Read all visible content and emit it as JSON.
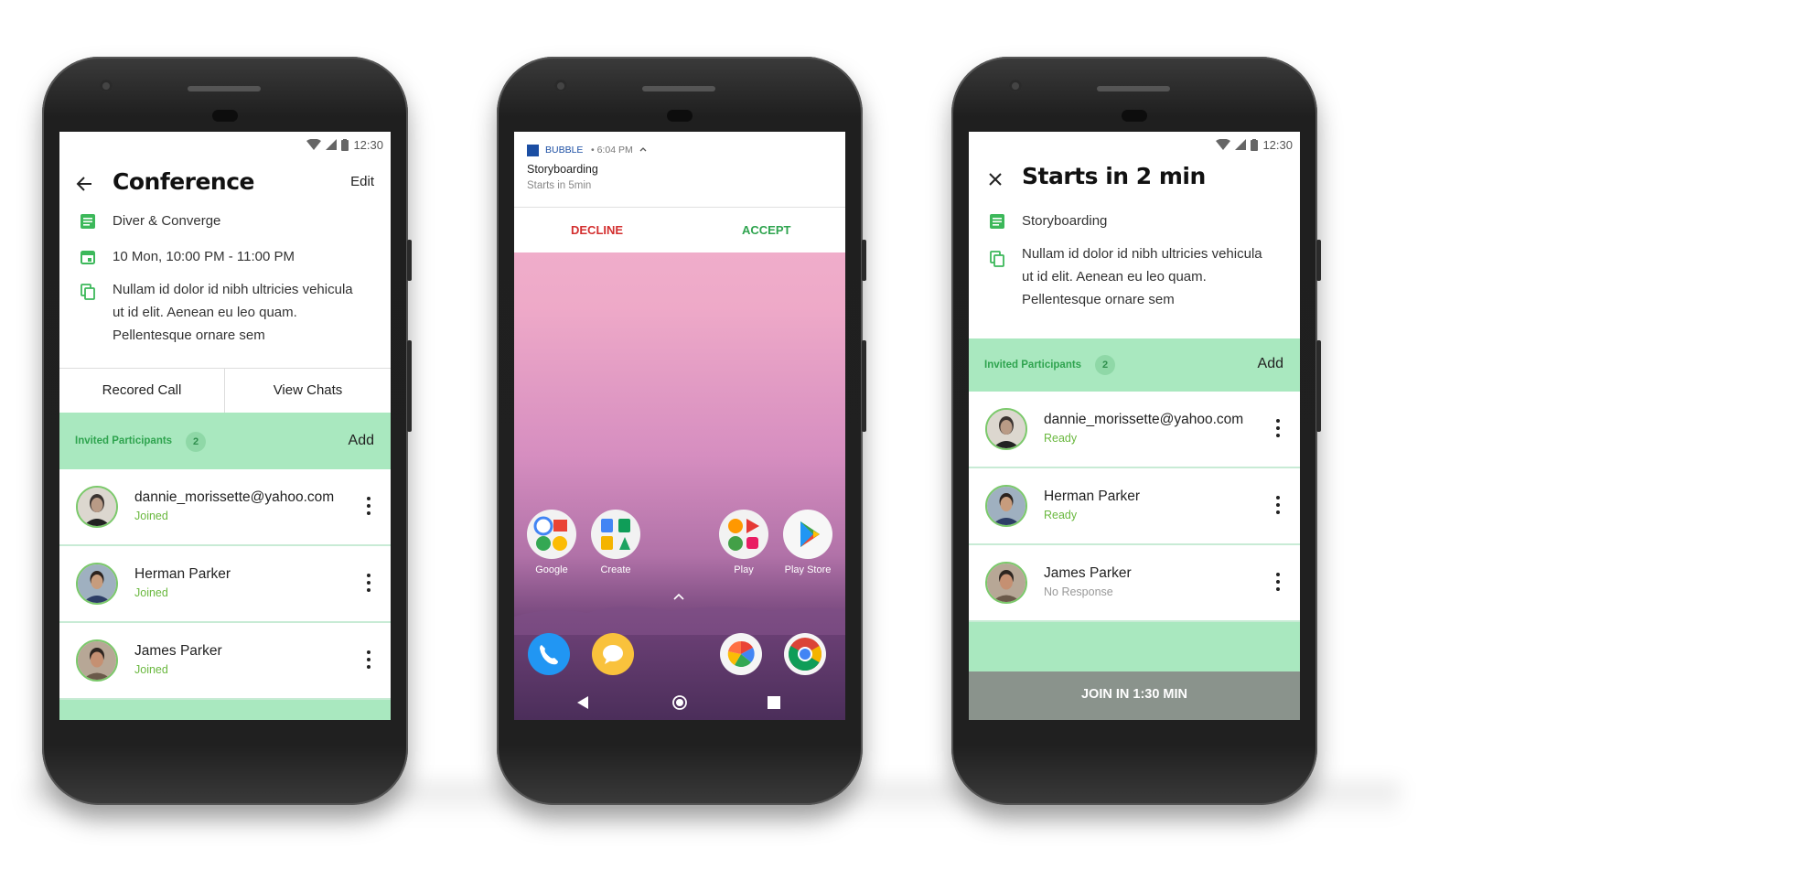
{
  "phone1": {
    "status_time": "12:30",
    "header": {
      "title": "Conference",
      "edit_label": "Edit"
    },
    "details": {
      "name": "Diver & Converge",
      "datetime": "10 Mon, 10:00 PM - 11:00 PM",
      "description_lines": [
        "Nullam id dolor id nibh ultricies vehicula",
        "ut id elit. Aenean eu leo quam.",
        "Pellentesque ornare sem"
      ]
    },
    "tabs": [
      "Recored Call",
      "View Chats"
    ],
    "participants_header": {
      "label": "Invited Participants",
      "count": "2",
      "add_label": "Add"
    },
    "participants": [
      {
        "name": "dannie_morissette@yahoo.com",
        "status": "Joined"
      },
      {
        "name": "Herman Parker",
        "status": "Joined"
      },
      {
        "name": "James Parker",
        "status": "Joined"
      }
    ]
  },
  "phone2": {
    "notification": {
      "app": "BUBBLE",
      "time": "• 6:04 PM",
      "title": "Storyboarding",
      "subtitle": "Starts in 5min",
      "decline_label": "DECLINE",
      "accept_label": "ACCEPT"
    },
    "apps": [
      {
        "label": "Google"
      },
      {
        "label": "Create"
      },
      {
        "label": "Play"
      },
      {
        "label": "Play Store"
      }
    ],
    "dock": [
      "phone-icon",
      "messages-icon",
      "photos-icon",
      "chrome-icon"
    ],
    "nav": [
      "back-icon",
      "home-icon",
      "recents-icon"
    ]
  },
  "phone3": {
    "status_time": "12:30",
    "header": {
      "title": "Starts in 2 min"
    },
    "details": {
      "name": "Storyboarding",
      "description_lines": [
        "Nullam id dolor id nibh ultricies vehicula",
        "ut id elit. Aenean eu leo quam.",
        "Pellentesque ornare sem"
      ]
    },
    "participants_header": {
      "label": "Invited Participants",
      "count": "2",
      "add_label": "Add"
    },
    "participants": [
      {
        "name": "dannie_morissette@yahoo.com",
        "status": "Ready"
      },
      {
        "name": "Herman Parker",
        "status": "Ready"
      },
      {
        "name": "James Parker",
        "status": "No Response"
      }
    ],
    "join_label": "JOIN IN 1:30 MIN"
  },
  "colors": {
    "accent_green": "#2fa44f",
    "band_green": "#a9e8bf",
    "decline_red": "#d32f2f",
    "join_bar": "#8a938c"
  }
}
